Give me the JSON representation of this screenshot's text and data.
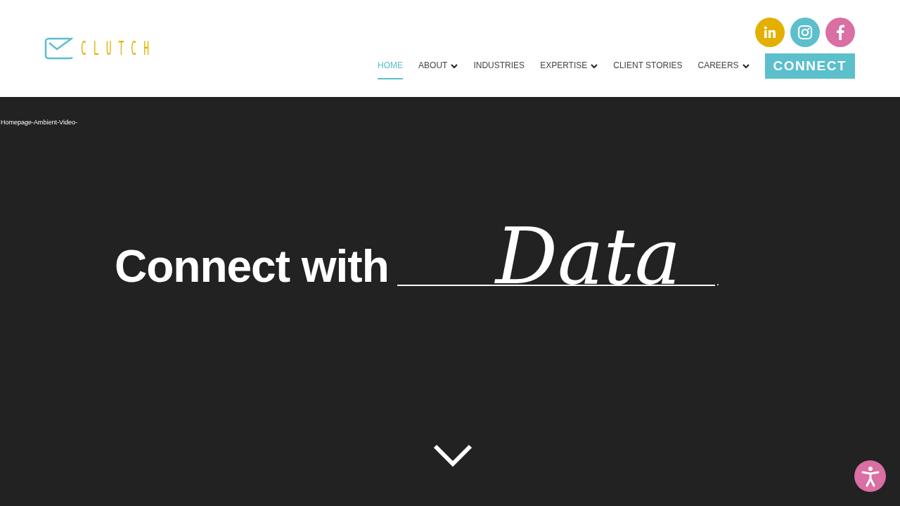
{
  "logo": {
    "text": "CLUTCH"
  },
  "nav": [
    {
      "label": "HOME",
      "selected": true,
      "dropdown": false
    },
    {
      "label": "ABOUT",
      "selected": false,
      "dropdown": true
    },
    {
      "label": "INDUSTRIES",
      "selected": false,
      "dropdown": false
    },
    {
      "label": "EXPERTISE",
      "selected": false,
      "dropdown": true
    },
    {
      "label": "CLIENT STORIES",
      "selected": false,
      "dropdown": false
    },
    {
      "label": "CAREERS",
      "selected": false,
      "dropdown": true
    }
  ],
  "social": [
    {
      "kind": "linkedin",
      "color": "#e3b000"
    },
    {
      "kind": "instagram",
      "color": "#5bbfcc"
    },
    {
      "kind": "facebook",
      "color": "#d96fa3"
    }
  ],
  "connect_button": "CONNECT",
  "hero": {
    "video_label": "Homepage-Ambient-Video-",
    "heading": "Connect with",
    "script_word": "Data",
    "end_mark": "."
  }
}
